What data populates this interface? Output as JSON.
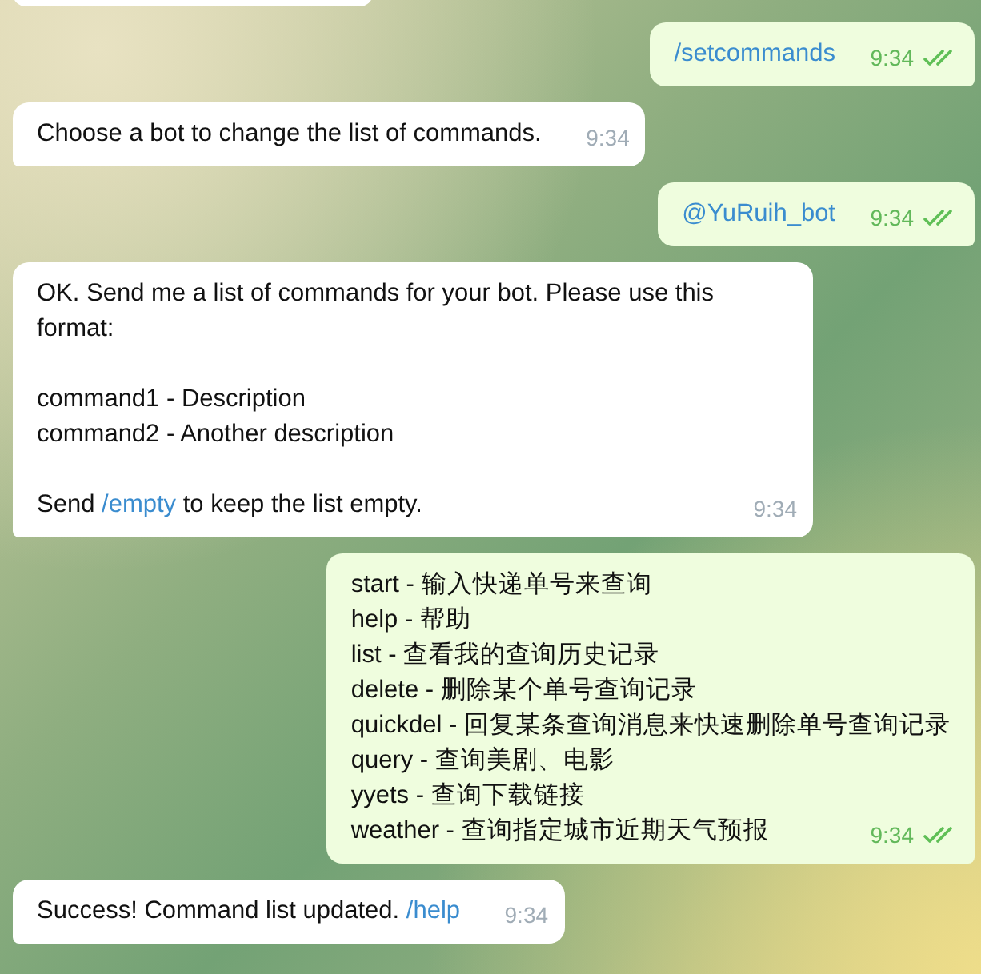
{
  "messages": [
    {
      "outgoing": true,
      "time": "9:34",
      "read": true,
      "paragraphs": [
        {
          "lines": [
            [
              {
                "text": "/setcommands",
                "link": true
              }
            ]
          ]
        }
      ]
    },
    {
      "outgoing": false,
      "time": "9:34",
      "paragraphs": [
        {
          "lines": [
            [
              {
                "text": "Choose a bot to change the list of commands.",
                "link": false
              }
            ]
          ]
        }
      ]
    },
    {
      "outgoing": true,
      "time": "9:34",
      "read": true,
      "paragraphs": [
        {
          "lines": [
            [
              {
                "text": "@YuRuih_bot",
                "link": true
              }
            ]
          ]
        }
      ]
    },
    {
      "outgoing": false,
      "time": "9:34",
      "paragraphs": [
        {
          "lines": [
            [
              {
                "text": "OK. Send me a list of commands for your bot. Please use this format:",
                "link": false
              }
            ]
          ]
        },
        {
          "lines": [
            [
              {
                "text": "command1 - Description",
                "link": false
              }
            ],
            [
              {
                "text": "command2 - Another description",
                "link": false
              }
            ]
          ]
        },
        {
          "lines": [
            [
              {
                "text": "Send ",
                "link": false
              },
              {
                "text": "/empty",
                "link": true
              },
              {
                "text": " to keep the list empty.",
                "link": false
              }
            ]
          ]
        }
      ]
    },
    {
      "outgoing": true,
      "time": "9:34",
      "read": true,
      "paragraphs": [
        {
          "lines": [
            [
              {
                "text": "start - 输入快递单号来查询",
                "link": false
              }
            ],
            [
              {
                "text": "help - 帮助",
                "link": false
              }
            ],
            [
              {
                "text": "list - 查看我的查询历史记录",
                "link": false
              }
            ],
            [
              {
                "text": "delete - 删除某个单号查询记录",
                "link": false
              }
            ],
            [
              {
                "text": "quickdel - 回复某条查询消息来快速删除单号查询记录",
                "link": false
              }
            ],
            [
              {
                "text": "query - 查询美剧、电影",
                "link": false
              }
            ],
            [
              {
                "text": "yyets - 查询下载链接",
                "link": false
              }
            ],
            [
              {
                "text": "weather - 查询指定城市近期天气预报",
                "link": false
              }
            ]
          ]
        }
      ]
    },
    {
      "outgoing": false,
      "time": "9:34",
      "paragraphs": [
        {
          "lines": [
            [
              {
                "text": "Success! Command list updated. ",
                "link": false
              },
              {
                "text": "/help",
                "link": true
              }
            ]
          ]
        }
      ]
    }
  ]
}
